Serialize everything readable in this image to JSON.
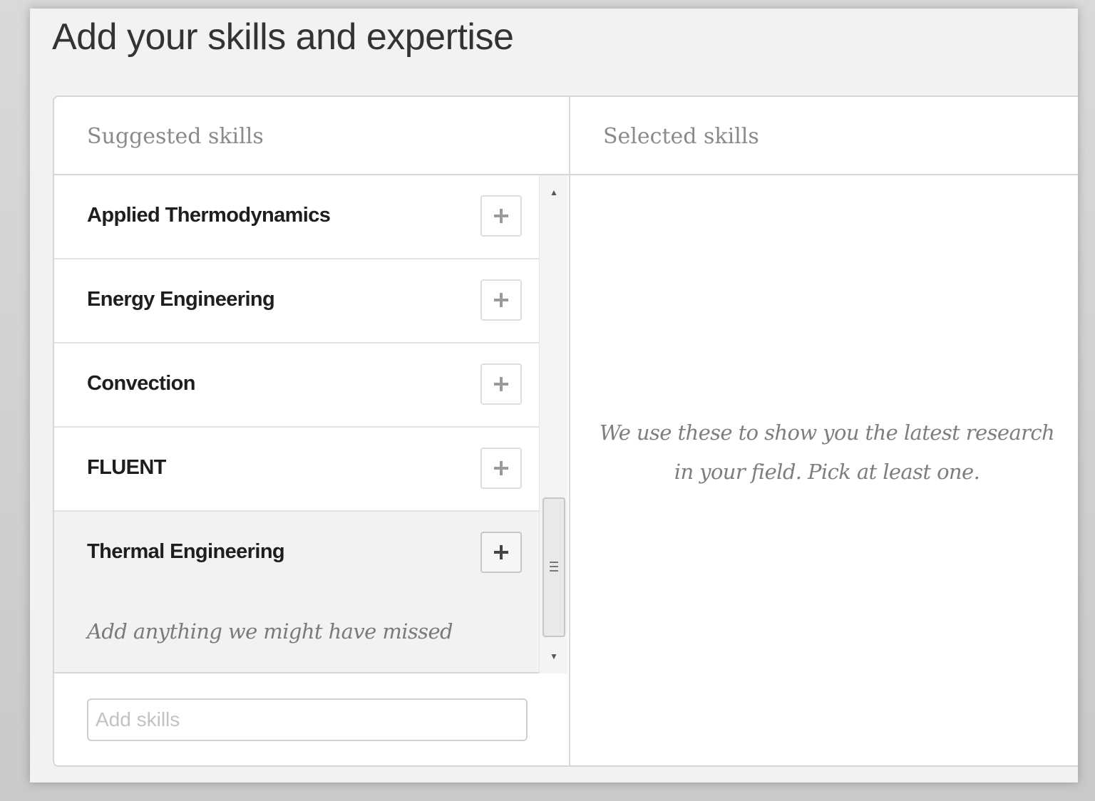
{
  "page": {
    "title": "Add your skills and expertise"
  },
  "suggested": {
    "header": "Suggested skills",
    "items": [
      {
        "label": "Applied Thermodynamics"
      },
      {
        "label": "Energy Engineering"
      },
      {
        "label": "Convection"
      },
      {
        "label": "FLUENT"
      },
      {
        "label": "Thermal Engineering"
      }
    ],
    "missed_text": "Add anything we might have missed",
    "input_placeholder": "Add skills",
    "input_value": ""
  },
  "selected": {
    "header": "Selected skills",
    "empty_message": "We use these to show you the latest research in your field. Pick at least one."
  },
  "icons": {
    "add": "plus-icon",
    "scroll_up": "arrow-up-icon",
    "scroll_down": "arrow-down-icon",
    "scroll_grip": "grip-icon"
  },
  "colors": {
    "title_text": "#333333",
    "header_text": "#8a8a8a",
    "skill_text": "#1e1e1e",
    "muted_italic": "#7a7a7a",
    "panel_border": "#d6d6d6",
    "hover_row": "#f2f2f2"
  }
}
